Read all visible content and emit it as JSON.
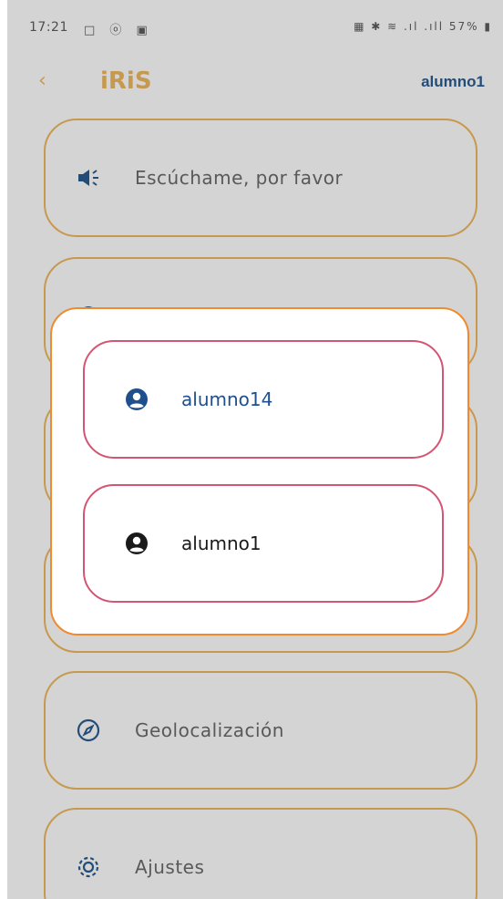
{
  "status_bar": {
    "time": "17:21",
    "left_icons": "□ ⓞ ▣",
    "right_icons": "▦ ✱ ≋ .ıl .ıll 57% ▮"
  },
  "header": {
    "back_icon": "chevron-left-icon",
    "title": "iRiS",
    "user": "alumno1"
  },
  "menu": {
    "items": [
      {
        "label": "Escúchame, por favor",
        "icon": "megaphone-icon"
      },
      {
        "label": "",
        "icon": "circle-icon"
      },
      {
        "label": "",
        "icon": ""
      },
      {
        "label": "",
        "icon": ""
      },
      {
        "label": "Geolocalización",
        "icon": "compass-icon"
      },
      {
        "label": "Ajustes",
        "icon": "gear-icon"
      }
    ]
  },
  "dialog": {
    "options": [
      {
        "label": "alumno14",
        "icon": "account-circle-icon",
        "color": "#1f4f8d"
      },
      {
        "label": "alumno1",
        "icon": "account-circle-icon",
        "color": "#1a1a1a"
      }
    ]
  },
  "colors": {
    "accent_orange": "#f0b860",
    "dialog_border": "#f08a2e",
    "option_border": "#d25574",
    "brand_blue": "#2a5d91"
  }
}
